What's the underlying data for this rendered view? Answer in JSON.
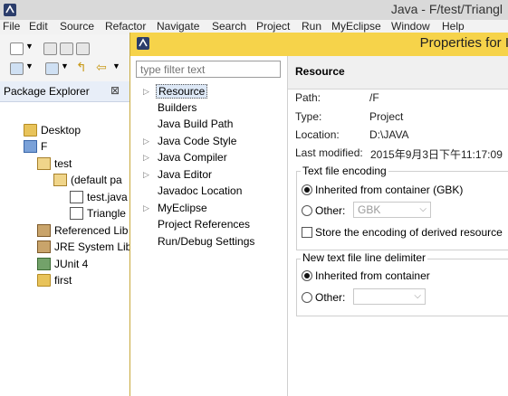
{
  "window": {
    "title": "Java - F/test/Triangl"
  },
  "menu": [
    "File",
    "Edit",
    "Source",
    "Refactor",
    "Navigate",
    "Search",
    "Project",
    "Run",
    "MyEclipse",
    "Window",
    "Help"
  ],
  "package_explorer": {
    "title": "Package Explorer",
    "close_glyph": "⊠",
    "tree": [
      {
        "label": "Desktop",
        "icon": "folder-icon"
      },
      {
        "label": "F",
        "icon": "project-icon"
      },
      {
        "label": "test",
        "icon": "source-folder-icon"
      },
      {
        "label": "(default pa",
        "icon": "package-icon"
      },
      {
        "label": "test.java",
        "icon": "java-file-icon"
      },
      {
        "label": "Triangle",
        "icon": "java-file-icon"
      },
      {
        "label": "Referenced Lib",
        "icon": "library-icon"
      },
      {
        "label": "JRE System Lib",
        "icon": "library-icon"
      },
      {
        "label": "JUnit 4",
        "icon": "junit-icon"
      },
      {
        "label": "first",
        "icon": "folder-icon"
      }
    ]
  },
  "dialog": {
    "title": "Properties for I",
    "filter_placeholder": "type filter text",
    "nav": [
      {
        "label": "Resource",
        "expandable": true,
        "selected": true
      },
      {
        "label": "Builders",
        "expandable": false
      },
      {
        "label": "Java Build Path",
        "expandable": false
      },
      {
        "label": "Java Code Style",
        "expandable": true
      },
      {
        "label": "Java Compiler",
        "expandable": true
      },
      {
        "label": "Java Editor",
        "expandable": true
      },
      {
        "label": "Javadoc Location",
        "expandable": false
      },
      {
        "label": "MyEclipse",
        "expandable": true
      },
      {
        "label": "Project References",
        "expandable": false
      },
      {
        "label": "Run/Debug Settings",
        "expandable": false
      }
    ],
    "page": {
      "title": "Resource",
      "path_label": "Path:",
      "path_value": "/F",
      "type_label": "Type:",
      "type_value": "Project",
      "location_label": "Location:",
      "location_value": "D:\\JAVA",
      "modified_label": "Last modified:",
      "modified_value": "2015年9月3日下午11:17:09",
      "encoding": {
        "title": "Text file encoding",
        "inherited_label": "Inherited from container (GBK)",
        "other_label": "Other:",
        "other_value": "GBK",
        "store_label": "Store the encoding of derived resource"
      },
      "delimiter": {
        "title": "New text file line delimiter",
        "inherited_label": "Inherited from container",
        "other_label": "Other:",
        "other_value": ""
      }
    }
  }
}
